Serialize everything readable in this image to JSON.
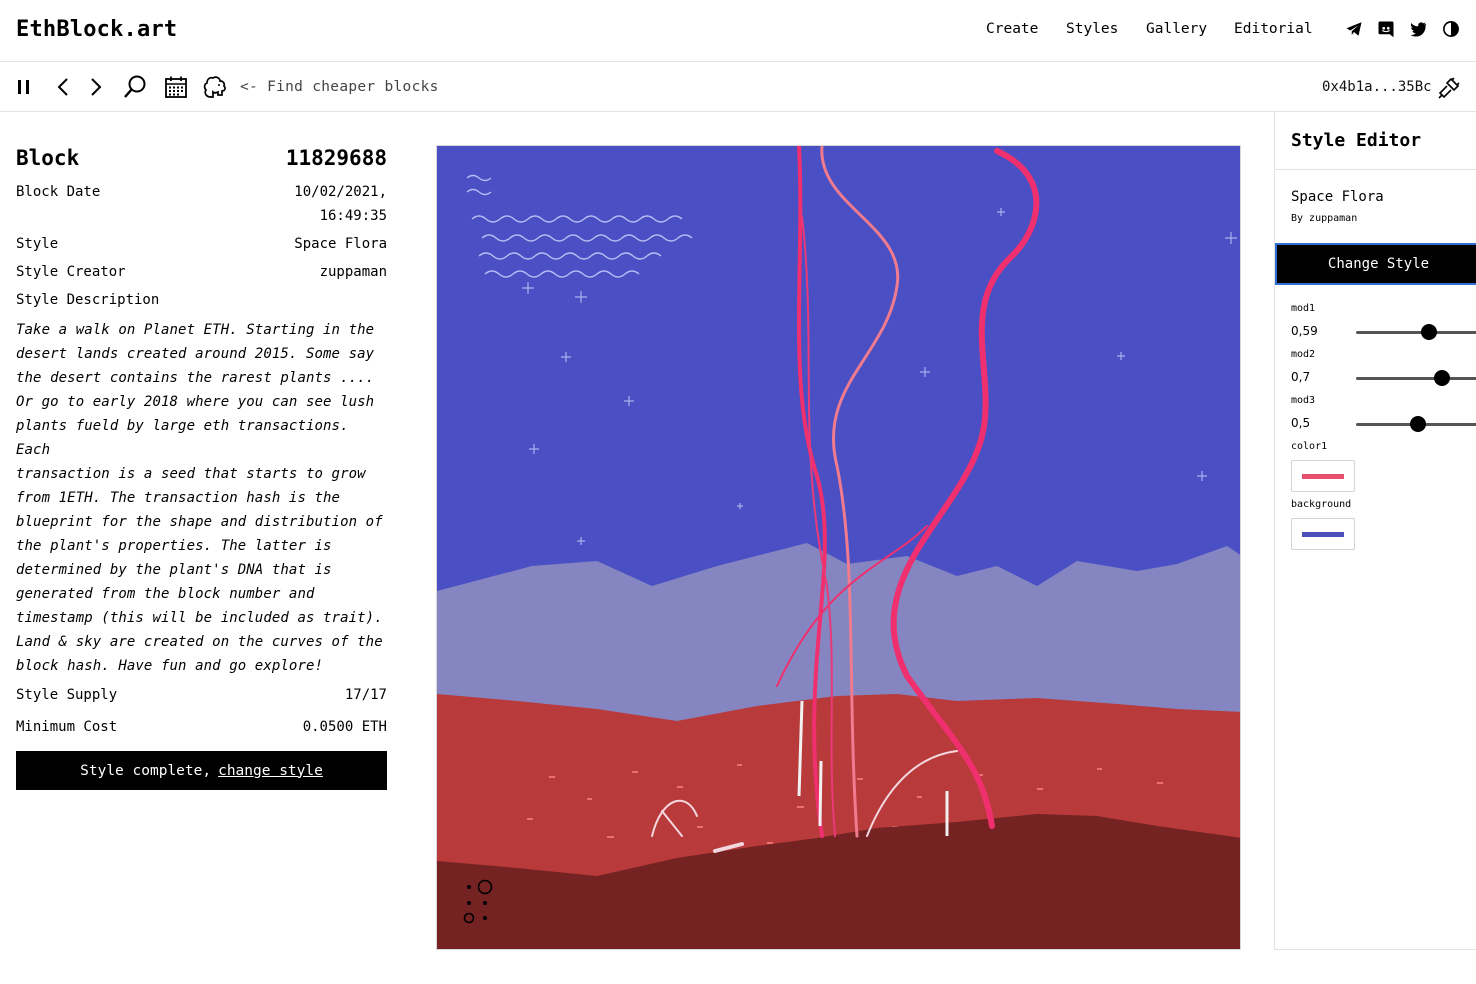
{
  "header": {
    "logo": "EthBlock.art",
    "nav": [
      "Create",
      "Styles",
      "Gallery",
      "Editorial"
    ],
    "social_icons": [
      "telegram-icon",
      "discord-icon",
      "twitter-icon",
      "theme-toggle-icon"
    ]
  },
  "toolbar": {
    "icons": [
      "pause-icon",
      "chevron-left-icon",
      "chevron-right-icon",
      "search-icon",
      "calendar-icon",
      "squirrel-icon"
    ],
    "find_text": "<- Find cheaper blocks",
    "address": "0x4b1a...35Bc",
    "connect_icon": "plug-icon"
  },
  "block": {
    "title": "Block",
    "number": "11829688",
    "date_label": "Block Date",
    "date": "10/02/2021,",
    "time": "16:49:35",
    "style_label": "Style",
    "style": "Space Flora",
    "creator_label": "Style Creator",
    "creator": "zuppaman",
    "description_label": "Style Description",
    "description_lines": [
      "Take a walk on Planet ETH. Starting in the",
      "desert lands created around 2015. Some say",
      "the desert contains the rarest plants ....",
      "Or go to early 2018 where you can see lush",
      "plants fueld by large eth transactions. Each",
      "transaction is a seed that starts to grow",
      "from 1ETH. The transaction hash is the",
      "blueprint for the shape and distribution of",
      "the plant's properties. The latter is",
      "determined by the plant's DNA that is",
      "generated from the block number and",
      "timestamp (this will be included as trait).",
      "Land & sky are created on the curves of the",
      "block hash. Have fun and go explore!"
    ],
    "supply_label": "Style Supply",
    "supply": "17/17",
    "cost_label": "Minimum Cost",
    "cost": "0.0500 ETH",
    "complete_text": "Style complete,",
    "complete_link": "change style"
  },
  "artwork": {
    "sky_color": "#4a50c4",
    "mountain_color": "#8585c2",
    "land_color": "#b83a3a",
    "foreground_color": "#742222",
    "plant_color": "#f0306e"
  },
  "editor": {
    "title": "Style Editor",
    "style_name": "Space Flora",
    "by": "By zuppaman",
    "change_button": "Change Style",
    "mods": [
      {
        "label": "mod1",
        "value": "0,59",
        "level": 0.59
      },
      {
        "label": "mod2",
        "value": "0,7",
        "level": 0.7
      },
      {
        "label": "mod3",
        "value": "0,5",
        "level": 0.5
      }
    ],
    "color1_label": "color1",
    "color1": "#e8506e",
    "background_label": "background",
    "background": "#4a50b8"
  }
}
